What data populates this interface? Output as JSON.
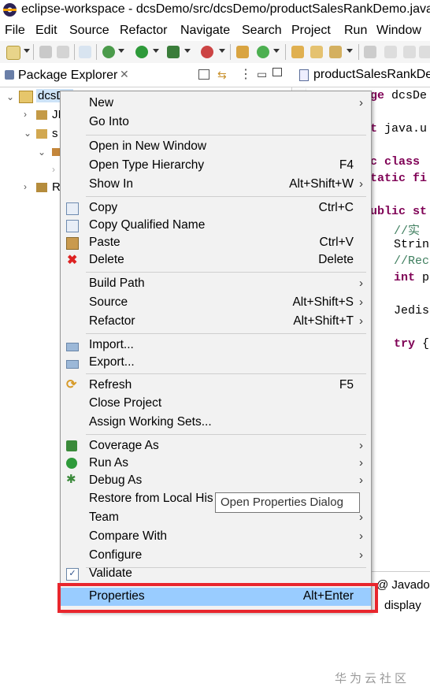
{
  "window": {
    "title": "eclipse-workspace - dcsDemo/src/dcsDemo/productSalesRankDemo.java"
  },
  "menubar": [
    "File",
    "Edit",
    "Source",
    "Refactor",
    "Navigate",
    "Search",
    "Project",
    "Run",
    "Window"
  ],
  "package_explorer": {
    "tab_label": "Package Explorer",
    "tree": [
      "dcsDe",
      "JI",
      "s",
      "R"
    ]
  },
  "editor": {
    "tab_label": "productSalesRankDe",
    "lines": [
      {
        "kw": "ge",
        "text": " dcsDe"
      },
      {
        "kw": "t",
        "text": " java.u"
      },
      {
        "kw": "c class",
        "text": " "
      },
      {
        "kw": "tatic fi",
        "text": ""
      },
      {
        "kw": "ublic st",
        "text": ""
      },
      {
        "cm": "//实",
        "text": ""
      },
      {
        "text": "Strin"
      },
      {
        "cm": "//Rec",
        "text": ""
      },
      {
        "kw": "int",
        "text": " p"
      },
      {
        "text": "Jedis"
      },
      {
        "kw": "try",
        "text": " {"
      }
    ]
  },
  "bottom_panel": {
    "tab_label": "Javado",
    "text": "display"
  },
  "context_menu": {
    "items": [
      {
        "label": "New",
        "submenu": true
      },
      {
        "label": "Go Into"
      },
      {
        "label": "Open in New Window"
      },
      {
        "label": "Open Type Hierarchy",
        "accel": "F4"
      },
      {
        "label": "Show In",
        "accel": "Alt+Shift+W",
        "submenu": true
      },
      {
        "label": "Copy",
        "accel": "Ctrl+C",
        "icon": "copy-icon"
      },
      {
        "label": "Copy Qualified Name",
        "icon": "copy-qualified-icon"
      },
      {
        "label": "Paste",
        "accel": "Ctrl+V",
        "icon": "paste-icon"
      },
      {
        "label": "Delete",
        "accel": "Delete",
        "icon": "delete-icon"
      },
      {
        "label": "Build Path",
        "submenu": true
      },
      {
        "label": "Source",
        "accel": "Alt+Shift+S",
        "submenu": true
      },
      {
        "label": "Refactor",
        "accel": "Alt+Shift+T",
        "submenu": true
      },
      {
        "label": "Import...",
        "icon": "import-icon"
      },
      {
        "label": "Export...",
        "icon": "export-icon"
      },
      {
        "label": "Refresh",
        "accel": "F5",
        "icon": "refresh-icon"
      },
      {
        "label": "Close Project"
      },
      {
        "label": "Assign Working Sets..."
      },
      {
        "label": "Coverage As",
        "submenu": true,
        "icon": "coverage-icon"
      },
      {
        "label": "Run As",
        "submenu": true,
        "icon": "run-icon"
      },
      {
        "label": "Debug As",
        "submenu": true,
        "icon": "debug-icon"
      },
      {
        "label": "Restore from Local His"
      },
      {
        "label": "Team",
        "submenu": true
      },
      {
        "label": "Compare With",
        "submenu": true
      },
      {
        "label": "Configure",
        "submenu": true
      },
      {
        "label": "Validate",
        "icon": "checkbox-checked-icon"
      },
      {
        "label": "Properties",
        "accel": "Alt+Enter"
      }
    ],
    "tooltip": "Open Properties Dialog"
  },
  "watermark": "华为云社区",
  "colors": {
    "highlight_border": "#e8262d",
    "selected_item": "#99ccff",
    "menu_bg": "#f2f2f2"
  }
}
